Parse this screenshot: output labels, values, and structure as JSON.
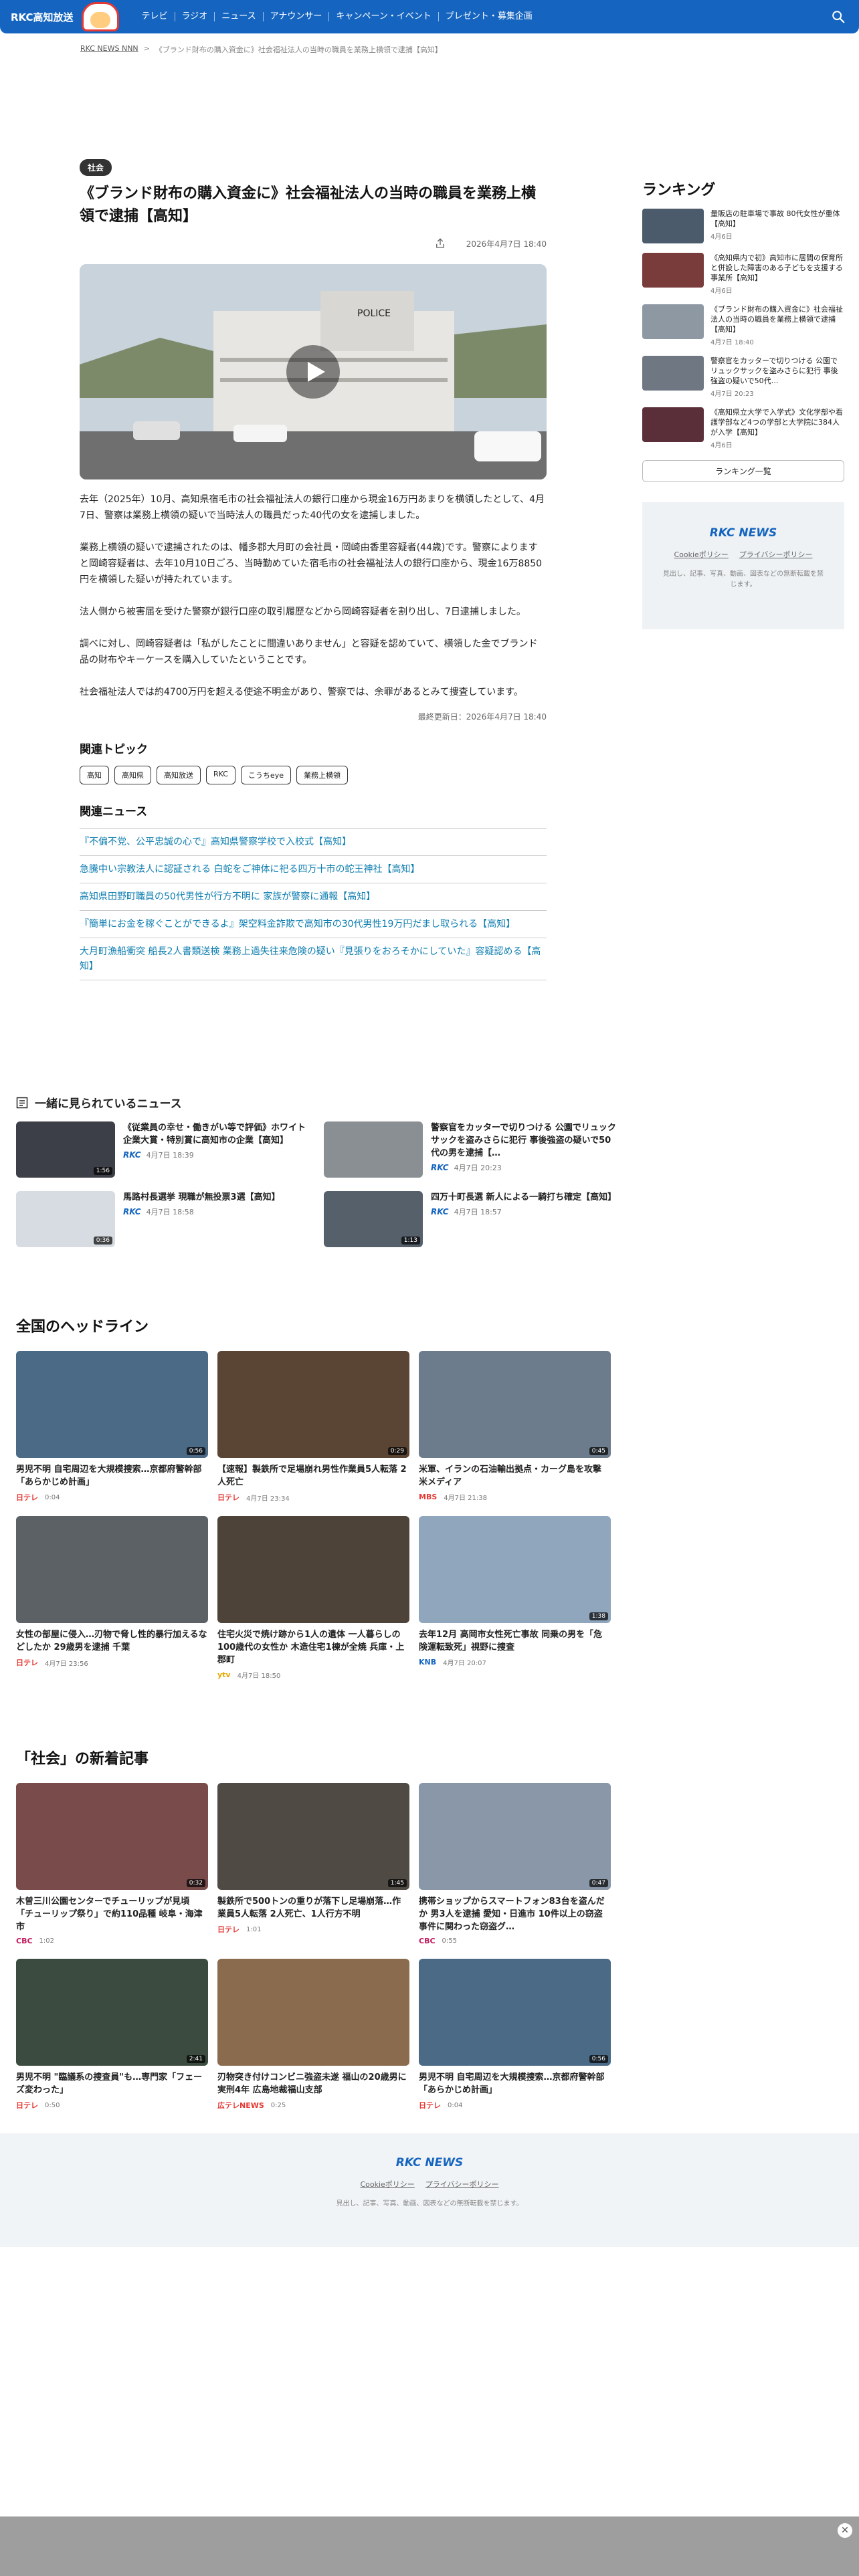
{
  "header": {
    "logo": "RKC高知放送",
    "nav": [
      "テレビ",
      "ラジオ",
      "ニュース",
      "アナウンサー",
      "キャンペーン・イベント",
      "プレゼント・募集企画"
    ]
  },
  "breadcrumb": {
    "home": "RKC NEWS NNN",
    "current": "《ブランド財布の購入資金に》社会福祉法人の当時の職員を業務上横領で逮捕【高知】"
  },
  "article": {
    "category": "社会",
    "title": "《ブランド財布の購入資金に》社会福祉法人の当時の職員を業務上横領で逮捕【高知】",
    "date": "2026年4月7日 18:40",
    "paragraphs": [
      "去年（2025年）10月、高知県宿毛市の社会福祉法人の銀行口座から現金16万円あまりを横領したとして、4月7日、警察は業務上横領の疑いで当時法人の職員だった40代の女を逮捕しました。",
      "業務上横領の疑いで逮捕されたのは、幡多郡大月町の会社員・岡崎由香里容疑者(44歳)です。警察によりますと岡崎容疑者は、去年10月10日ごろ、当時勤めていた宿毛市の社会福祉法人の銀行口座から、現金16万8850円を横領した疑いが持たれています。",
      "法人側から被害届を受けた警察が銀行口座の取引履歴などから岡崎容疑者を割り出し、7日逮捕しました。",
      "調べに対し、岡崎容疑者は「私がしたことに間違いありません」と容疑を認めていて、横領した金でブランド品の財布やキーケースを購入していたということです。",
      "社会福祉法人では約4700万円を超える使途不明金があり、警察では、余罪があるとみて捜査しています。"
    ],
    "updated": "最終更新日：2026年4月7日 18:40",
    "topics_heading": "関連トピック",
    "tags": [
      "高知",
      "高知県",
      "高知放送",
      "RKC",
      "こうちeye",
      "業務上横領"
    ],
    "news_heading": "関連ニュース",
    "related": [
      "『不偏不党、公平忠誠の心で』高知県警察学校で入校式【高知】",
      "急騰中い宗教法人に認証される 白蛇をご神体に祀る四万十市の蛇王神社【高知】",
      "高知県田野町職員の50代男性が行方不明に 家族が警察に通報【高知】",
      "『簡単にお金を稼ぐことができるよ』架空料金詐欺で高知市の30代男性19万円だまし取られる【高知】",
      "大月町漁船衝突 船長2人書類送検 業務上過失往来危険の疑い『見張りをおろそかにしていた』容疑認める【高知】"
    ]
  },
  "sidebar": {
    "ranking_heading": "ランキング",
    "ranking": [
      {
        "title": "量販店の駐車場で事故 80代女性が重体【高知】",
        "date": "4月6日"
      },
      {
        "title": "《高知県内で初》高知市に居間の保育所と併設した障害のある子どもを支援する事業所【高知】",
        "date": "4月6日"
      },
      {
        "title": "《ブランド財布の購入資金に》社会福祉法人の当時の職員を業務上横領で逮捕【高知】",
        "date": "4月7日 18:40"
      },
      {
        "title": "警察官をカッターで切りつける 公園でリュックサックを盗みさらに犯行 事後強盗の疑いで50代…",
        "date": "4月7日 20:23"
      },
      {
        "title": "《高知県立大学で入学式》文化学部や看護学部など4つの学部と大学院に384人が入学【高知】",
        "date": "4月6日"
      }
    ],
    "ranking_more": "ランキング一覧",
    "footer_logo": "RKC NEWS",
    "cookie": "Cookieポリシー",
    "privacy": "プライバシーポリシー",
    "copyright": "見出し、記事、写真、動画、図表などの無断転載を禁じます。"
  },
  "together": {
    "heading": "一緒に見られているニュース",
    "items": [
      {
        "title": "《従業員の幸せ・働きがい等で評価》ホワイト企業大賞・特別賞に高知市の企業【高知】",
        "source": "RKC",
        "date": "4月7日 18:39",
        "dur": "1:56"
      },
      {
        "title": "警察官をカッターで切りつける 公園でリュックサックを盗みさらに犯行 事後強盗の疑いで50代の男を逮捕【…",
        "source": "RKC",
        "date": "4月7日 20:23",
        "dur": ""
      },
      {
        "title": "馬路村長選挙 現職が無投票3選【高知】",
        "source": "RKC",
        "date": "4月7日 18:58",
        "dur": "0:36"
      },
      {
        "title": "四万十町長選 新人による一騎打ち確定【高知】",
        "source": "RKC",
        "date": "4月7日 18:57",
        "dur": "1:13"
      }
    ]
  },
  "national": {
    "heading": "全国のヘッドライン",
    "cards": [
      {
        "title": "男児不明 自宅周辺を大規模捜索…京都府警幹部「あらかじめ計画」",
        "source": "日テレ",
        "date": "0:04",
        "dur": "0:56"
      },
      {
        "title": "【速報】製鉄所で足場崩れ男性作業員5人転落 2人死亡",
        "source": "日テレ",
        "date": "4月7日 23:34",
        "dur": "0:29"
      },
      {
        "title": "米軍、イランの石油輸出拠点・カーグ島を攻撃 米メディア",
        "source": "MBS",
        "date": "4月7日 21:38",
        "dur": "0:45"
      },
      {
        "title": "女性の部屋に侵入…刃物で脅し性的暴行加えるなどしたか 29歳男を逮捕 千葉",
        "source": "日テレ",
        "date": "4月7日 23:56",
        "dur": ""
      },
      {
        "title": "住宅火災で焼け跡から1人の遺体 一人暮らしの100歳代の女性か 木造住宅1棟が全焼 兵庫・上郡町",
        "source": "ytv",
        "date": "4月7日 18:50",
        "dur": ""
      },
      {
        "title": "去年12月 高岡市女性死亡事故 同乗の男を「危険運転致死」視野に捜査",
        "source": "KNB",
        "date": "4月7日 20:07",
        "dur": "1:38"
      }
    ]
  },
  "social": {
    "heading": "「社会」の新着記事",
    "cards": [
      {
        "title": "木曽三川公園センターでチューリップが見頃 「チューリップ祭り」で約110品種 岐阜・海津市",
        "source": "CBC",
        "date": "1:02",
        "dur": "0:32"
      },
      {
        "title": "製鉄所で500トンの重りが落下し足場崩落…作業員5人転落 2人死亡、1人行方不明",
        "source": "日テレ",
        "date": "1:01",
        "dur": "1:45"
      },
      {
        "title": "携帯ショップからスマートフォン83台を盗んだか 男3人を逮捕 愛知・日進市 10件以上の窃盗事件に関わった窃盗グ…",
        "source": "CBC",
        "date": "0:55",
        "dur": "0:47"
      },
      {
        "title": "男児不明 \"臨議系の捜査員\"も…専門家「フェーズ変わった」",
        "source": "日テレ",
        "date": "0:50",
        "dur": "2:41"
      },
      {
        "title": "刃物突き付けコンビニ強盗未遂 福山の20歳男に実刑4年 広島地裁福山支部",
        "source": "広テレNEWS",
        "date": "0:25",
        "dur": ""
      },
      {
        "title": "男児不明 自宅周辺を大規模捜索…京都府警幹部「あらかじめ計画」",
        "source": "日テレ",
        "date": "0:04",
        "dur": "0:56"
      }
    ]
  },
  "footer": {
    "logo": "RKC NEWS",
    "cookie": "Cookieポリシー",
    "privacy": "プライバシーポリシー",
    "copyright": "見出し、記事、写真、動画、図表などの無断転載を禁じます。"
  }
}
